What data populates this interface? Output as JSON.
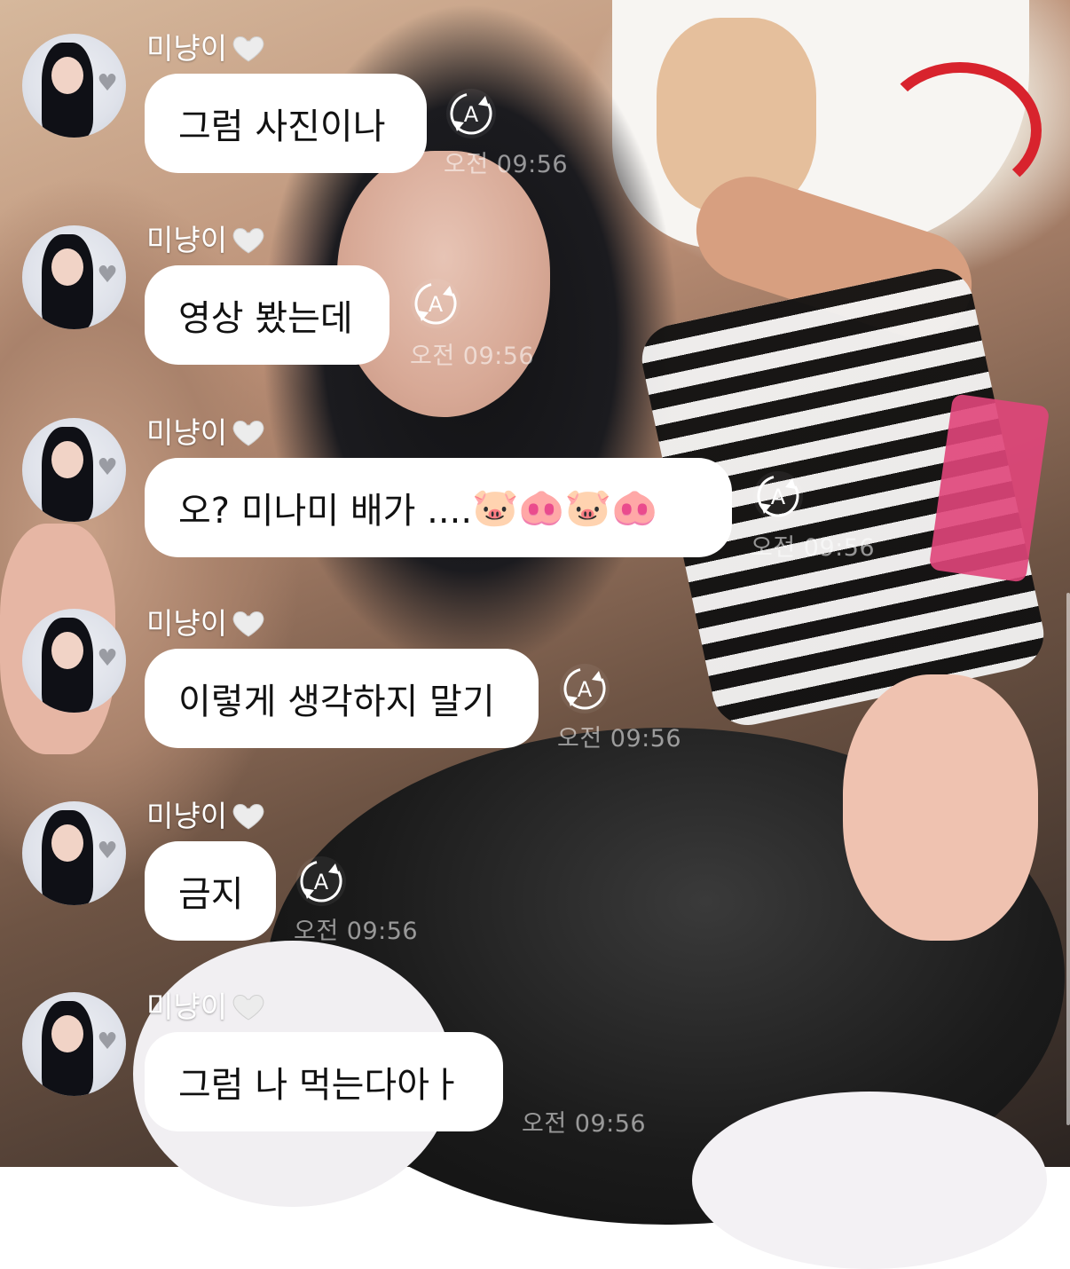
{
  "chat": {
    "messages": [
      {
        "sender": "미냥이",
        "text": "그럼 사진이나",
        "time": "오전 09:56",
        "translate_icon": "auto-translate-icon"
      },
      {
        "sender": "미냥이",
        "text": "영상 봤는데",
        "time": "오전 09:56",
        "translate_icon": "auto-translate-icon"
      },
      {
        "sender": "미냥이",
        "text": "오? 미나미 배가 ....",
        "emojis": [
          "🐷",
          "🐽",
          "🐷",
          "🐽"
        ],
        "time": "오전 09:56",
        "translate_icon": "auto-translate-icon"
      },
      {
        "sender": "미냥이",
        "text": "이렇게 생각하지 말기",
        "time": "오전 09:56",
        "translate_icon": "auto-translate-icon"
      },
      {
        "sender": "미냥이",
        "text": "금지",
        "time": "오전 09:56",
        "translate_icon": "auto-translate-icon"
      },
      {
        "sender": "미냥이",
        "text": "그럼 나 먹는다아ㅏ",
        "time": "오전 09:56"
      }
    ]
  },
  "icons": {
    "heart": "white-heart-icon",
    "translate": "auto-translate-icon"
  },
  "colors": {
    "bubble": "#ffffff",
    "name_text": "#ffffff",
    "time_text": "#ffffff"
  }
}
